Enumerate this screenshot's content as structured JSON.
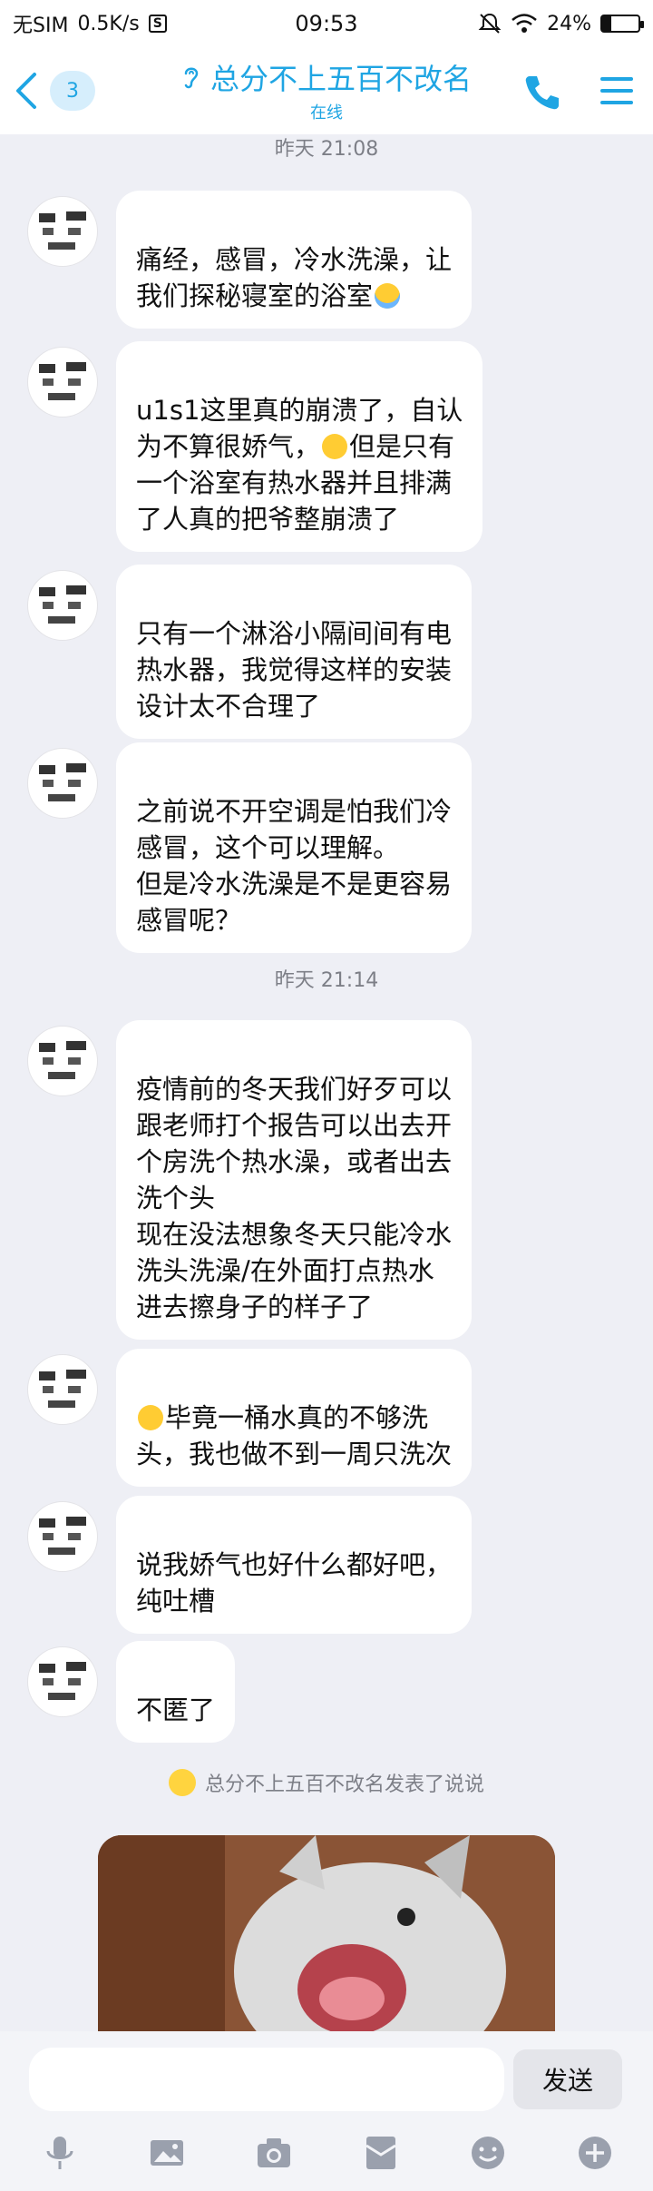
{
  "status_bar": {
    "carrier": "无SIM",
    "speed": "0.5K/s",
    "s_icon": "S",
    "time": "09:53",
    "battery": "24%",
    "battery_level": 0.24,
    "icons": [
      "mute-icon",
      "wifi-icon",
      "battery-icon"
    ]
  },
  "header": {
    "unread_count": "3",
    "title": "总分不上五百不改名",
    "status": "在线",
    "accent_color": "#1fa5e3"
  },
  "timestamps": [
    "昨天 21:08",
    "昨天 21:14"
  ],
  "messages": [
    {
      "text": "痛经，感冒，冷水洗澡，让\n我们探秘寝室的浴室",
      "emoji_after": "fearful-emoji"
    },
    {
      "text_before": "u1s1这里真的崩溃了，自认\n为不算很娇气，",
      "emoji": "sad-emoji",
      "text_after": "但是只有\n一个浴室有热水器并且排满\n了人真的把爷整崩溃了"
    },
    {
      "text": "只有一个淋浴小隔间间有电\n热水器，我觉得这样的安装\n设计太不合理了"
    },
    {
      "text": "之前说不开空调是怕我们冷\n感冒，这个可以理解。\n但是冷水洗澡是不是更容易\n感冒呢？"
    },
    {
      "text": "疫情前的冬天我们好歹可以\n跟老师打个报告可以出去开\n个房洗个热水澡，或者出去\n洗个头\n现在没法想象冬天只能冷水\n洗头洗澡/在外面打点热水\n进去擦身子的样子了"
    },
    {
      "emoji_before": "thinking-emoji",
      "text": "毕竟一桶水真的不够洗\n头，我也做不到一周只洗次"
    },
    {
      "text": "说我娇气也好什么都好吧，\n纯吐槽"
    },
    {
      "text": "不匿了"
    }
  ],
  "notice": {
    "text": "总分不上五百不改名发表了说说",
    "icon": "feed-icon"
  },
  "photo": {
    "description_icon": "dog-photo"
  },
  "input": {
    "value": "",
    "placeholder": ""
  },
  "send_label": "发送",
  "toolbar_icons": [
    "microphone-icon",
    "picture-icon",
    "camera-icon",
    "red-packet-icon",
    "emoji-icon",
    "plus-icon"
  ]
}
